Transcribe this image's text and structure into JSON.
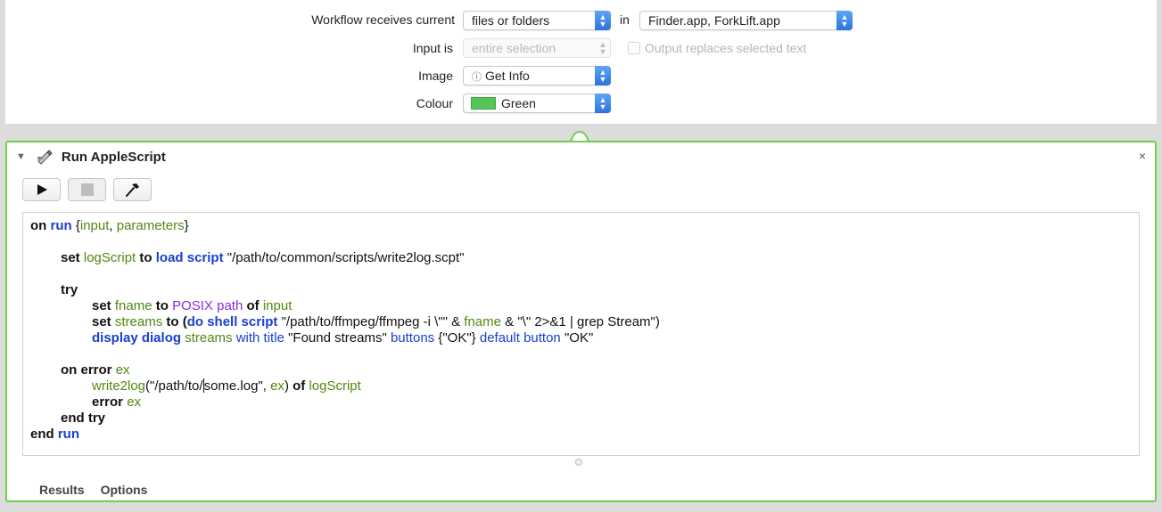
{
  "workflow": {
    "receives_label": "Workflow receives current",
    "receives_value": "files or folders",
    "in_label": "in",
    "apps_value": "Finder.app, ForkLift.app",
    "input_label": "Input is",
    "input_value": "entire selection",
    "output_replaces_label": "Output replaces selected text",
    "output_replaces_checked": false,
    "image_label": "Image",
    "image_value": "Get Info",
    "image_icon": "info-circle-icon",
    "colour_label": "Colour",
    "colour_value": "Green",
    "colour_hex": "#55c557"
  },
  "action": {
    "title": "Run AppleScript",
    "accent": "#6fd04c",
    "close_glyph": "×",
    "toolbar": [
      "run-button",
      "stop-button",
      "compile-button"
    ]
  },
  "code": {
    "l1": [
      "on",
      "run",
      "{",
      "input",
      ", ",
      "parameters",
      "}"
    ],
    "l2": [
      "set",
      "logScript",
      "to",
      "load script",
      "\"/path/to/common/scripts/write2log.scpt\""
    ],
    "l3": [
      "try"
    ],
    "l4": [
      "set",
      "fname",
      "to",
      "POSIX",
      "path",
      "of",
      "input"
    ],
    "l5": [
      "set",
      "streams",
      "to",
      "(",
      "do shell script",
      "\"/path/to/ffmpeg/ffmpeg -i \\\"\" & ",
      "fname",
      " & \"\\\" 2>&1 | grep Stream\")"
    ],
    "l6": [
      "display dialog",
      "streams",
      "with title",
      "\"Found streams\"",
      "buttons",
      "{\"OK\"}",
      "default button",
      "\"OK\""
    ],
    "l7": [
      "on error",
      "ex"
    ],
    "l8": [
      "write2log",
      "(\"/path/to/",
      "some.log\", ",
      "ex",
      ")",
      "of",
      "logScript"
    ],
    "l9": [
      "error",
      "ex"
    ],
    "l10": [
      "end try"
    ],
    "l11": [
      "end",
      "run"
    ]
  },
  "tabs": {
    "results": "Results",
    "options": "Options"
  }
}
